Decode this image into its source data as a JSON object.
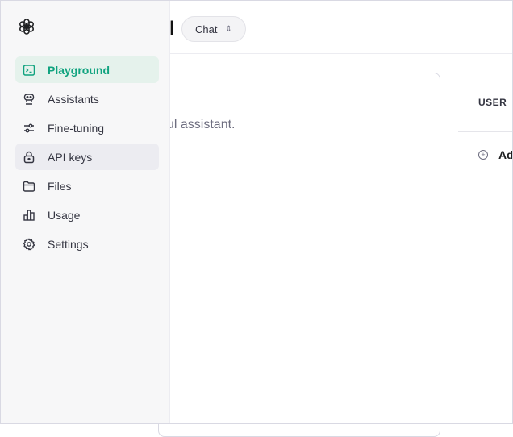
{
  "page": {
    "title_fragment": "l",
    "mode_select": {
      "value": "Chat"
    },
    "system_text": "ul assistant.",
    "user_label": "USER",
    "add_message_fragment": "Ad"
  },
  "sidebar": {
    "items": [
      {
        "label": "Playground",
        "icon": "terminal-icon",
        "active": true
      },
      {
        "label": "Assistants",
        "icon": "robot-icon"
      },
      {
        "label": "Fine-tuning",
        "icon": "sliders-icon"
      },
      {
        "label": "API keys",
        "icon": "lock-icon",
        "hover": true
      },
      {
        "label": "Files",
        "icon": "folder-icon"
      },
      {
        "label": "Usage",
        "icon": "bar-chart-icon"
      },
      {
        "label": "Settings",
        "icon": "gear-icon"
      }
    ]
  },
  "colors": {
    "accent": "#10a37f",
    "active_bg": "#e5f2ec",
    "sidebar_bg": "#f7f7f8"
  }
}
